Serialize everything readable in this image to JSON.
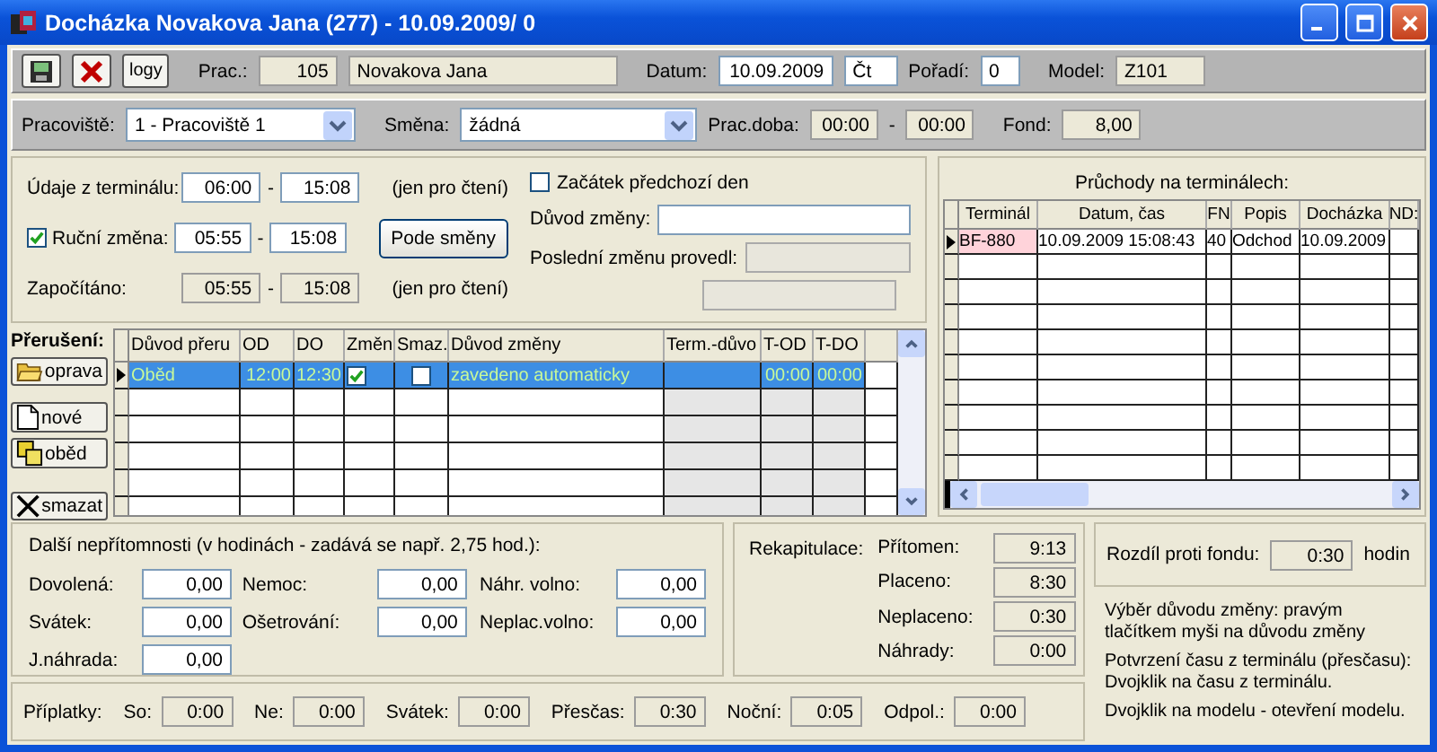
{
  "window": {
    "title": "Docházka Novakova Jana (277) - 10.09.2009/ 0"
  },
  "toolbar": {
    "logs_button": "logy",
    "employee_label": "Prac.:",
    "employee_number": "105",
    "employee_name": "Novakova Jana",
    "date_label": "Datum:",
    "date": "10.09.2009",
    "weekday": "Čt",
    "order_label": "Pořadí:",
    "order": "0",
    "model_label": "Model:",
    "model": "Z101"
  },
  "shift_bar": {
    "workplace_label": "Pracoviště:",
    "workplace": "1 - Pracoviště 1",
    "shift_label": "Směna:",
    "shift": "žádná",
    "work_time_label": "Prac.doba:",
    "work_time_from": "00:00",
    "work_time_separator": "-",
    "work_time_to": "00:00",
    "fund_label": "Fond:",
    "fund": "8,00"
  },
  "times": [
    {
      "kind": "plain",
      "label": "Údaje z terminálu:",
      "from": "06:00",
      "separator": "-",
      "to": "15:08",
      "readonly": false,
      "note": "(jen pro čtení)"
    },
    {
      "kind": "checkbox",
      "label": "Ruční změna:",
      "checked": true,
      "from": "05:55",
      "separator": "-",
      "to": "15:08",
      "readonly": false,
      "button": "Pode směny"
    },
    {
      "kind": "plain",
      "label": "Započítáno:",
      "from": "05:55",
      "separator": "-",
      "to": "15:08",
      "readonly": true,
      "note": "(jen pro čtení)"
    }
  ],
  "change": {
    "previous_day": {
      "label": "Začátek předchozí den",
      "checked": false
    },
    "reason_label": "Důvod změny:",
    "last_changed_label": "Poslední změnu provedl:"
  },
  "interruptions": {
    "label": "Přerušení:",
    "buttons": [
      {
        "kind": "edit",
        "label": "oprava"
      },
      {
        "kind": "new",
        "label": "nové"
      },
      {
        "kind": "lunch",
        "label": "oběd"
      },
      {
        "kind": "delete",
        "label": "smazat"
      }
    ],
    "columns": [
      "Důvod přeru",
      "OD",
      "DO",
      "Změn",
      "Smaz.",
      "Důvod změny",
      "Term.-důvo",
      "T-OD",
      "T-DO"
    ],
    "rows": [
      {
        "current": true,
        "selected": true,
        "reason": "Oběd",
        "from": "12:00",
        "to": "12:30",
        "changed": true,
        "deleted": false,
        "change_reason": "zavedeno automaticky",
        "terminal_from": "00:00",
        "terminal_to": "00:00"
      }
    ]
  },
  "terminals": {
    "title": "Průchody na terminálech:",
    "columns": [
      "Terminál",
      "Datum, čas",
      "FN",
      "Popis",
      "Docházka",
      "ND:"
    ],
    "rows": [
      {
        "current": true,
        "cells": [
          "BF-880",
          "10.09.2009 15:08:43",
          "40",
          "Odchod",
          "10.09.2009"
        ]
      }
    ]
  },
  "absences": {
    "title": "Další nepřítomnosti (v hodinách - zadává se např. 2,75 hod.):",
    "groups": [
      {
        "items": [
          {
            "label": "Dovolená:",
            "value": "0,00"
          },
          {
            "label": "Svátek:",
            "value": "0,00"
          },
          {
            "label": "J.náhrada:",
            "value": "0,00"
          }
        ]
      },
      {
        "items": [
          {
            "label": "Nemoc:",
            "value": "0,00"
          },
          {
            "label": "Ošetrování:",
            "value": "0,00"
          }
        ]
      },
      {
        "items": [
          {
            "label": "Náhr. volno:",
            "value": "0,00"
          },
          {
            "label": "Neplac.volno:",
            "value": "0,00"
          }
        ]
      }
    ]
  },
  "recap": {
    "label": "Rekapitulace:",
    "items": [
      {
        "label": "Přítomen:",
        "value": "9:13"
      },
      {
        "label": "Placeno:",
        "value": "8:30"
      },
      {
        "label": "Neplaceno:",
        "value": "0:30"
      },
      {
        "label": "Náhrady:",
        "value": "0:00"
      }
    ]
  },
  "difference": {
    "label": "Rozdíl proti fondu:",
    "value": "0:30",
    "unit": "hodin"
  },
  "notes": [
    "Výběr důvodu změny: pravým tlačítkem myši na důvodu změny",
    "Potvrzení času z terminálu (přesčasu): Dvojklik na času z terminálu.",
    "Dvojklik na modelu - otevření modelu."
  ],
  "surcharges": {
    "label": "Příplatky:",
    "items": [
      {
        "label": "So:",
        "value": "0:00"
      },
      {
        "label": "Ne:",
        "value": "0:00"
      },
      {
        "label": "Svátek:",
        "value": "0:00"
      },
      {
        "label": "Přesčas:",
        "value": "0:30"
      },
      {
        "label": "Noční:",
        "value": "0:05"
      },
      {
        "label": "Odpol.:",
        "value": "0:00"
      }
    ]
  }
}
